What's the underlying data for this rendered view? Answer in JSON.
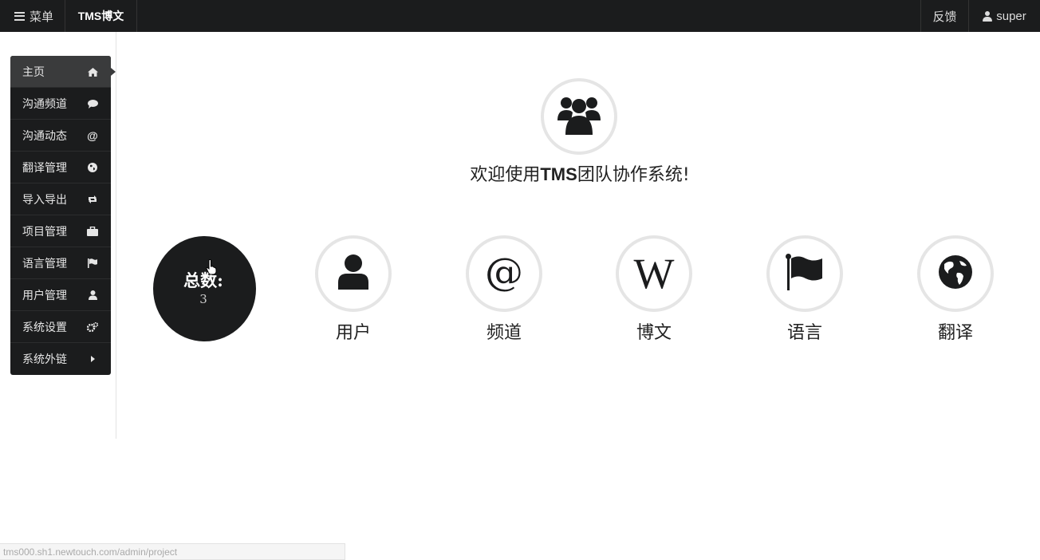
{
  "navbar": {
    "menu_label": "菜单",
    "brand": "TMS博文",
    "feedback": "反馈",
    "user": "super"
  },
  "sidebar": {
    "items": [
      {
        "label": "主页",
        "icon": "home-icon",
        "active": true
      },
      {
        "label": "沟通频道",
        "icon": "comment-icon"
      },
      {
        "label": "沟通动态",
        "icon": "at-icon"
      },
      {
        "label": "翻译管理",
        "icon": "globe-icon"
      },
      {
        "label": "导入导出",
        "icon": "retweet-icon"
      },
      {
        "label": "项目管理",
        "icon": "briefcase-icon"
      },
      {
        "label": "语言管理",
        "icon": "flag-icon"
      },
      {
        "label": "用户管理",
        "icon": "user-icon"
      },
      {
        "label": "系统设置",
        "icon": "cogs-icon"
      },
      {
        "label": "系统外链",
        "icon": "caret-right-icon"
      }
    ]
  },
  "hero": {
    "icon": "group-icon",
    "title_prefix": "欢迎使用",
    "title_brand": "TMS",
    "title_suffix": "团队协作系统!"
  },
  "total": {
    "label": "总数:",
    "value": "3"
  },
  "stats": [
    {
      "label": "用户",
      "icon": "user-icon"
    },
    {
      "label": "频道",
      "icon": "at-icon"
    },
    {
      "label": "博文",
      "icon": "wikipedia-icon"
    },
    {
      "label": "语言",
      "icon": "flag-icon"
    },
    {
      "label": "翻译",
      "icon": "globe-icon"
    }
  ],
  "status_bar": {
    "url": "tms000.sh1.newtouch.com/admin/project"
  },
  "colors": {
    "dark": "#1b1c1d",
    "active": "#3a3b3c",
    "ring": "#e5e5e5"
  }
}
